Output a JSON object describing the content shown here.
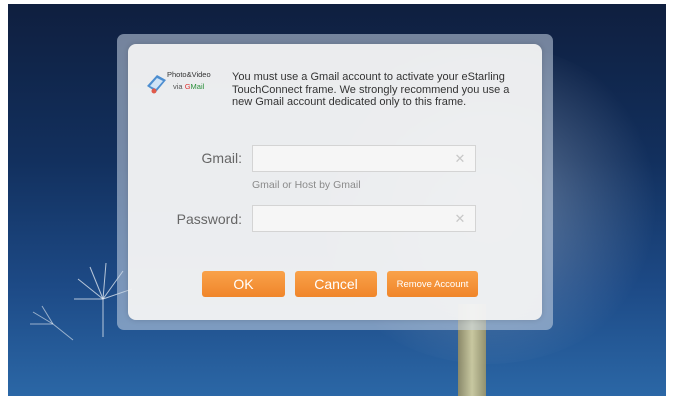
{
  "background": {
    "sky_colors": [
      "#0f1f3f",
      "#12305e",
      "#2b67a6"
    ],
    "description_icon": "dandelion-wallpaper"
  },
  "dialog": {
    "logo": {
      "icon": "photo-video-gmail-logo",
      "line1": "Photo&Video",
      "line2_prefix": "via",
      "line2_g": "G",
      "line2_m": "M",
      "line2_suffix": "ail"
    },
    "message": "You must use a Gmail account to activate your eStarling TouchConnect frame. We strongly recommend you use a new Gmail account dedicated only to this frame.",
    "gmail": {
      "label": "Gmail:",
      "value": "",
      "placeholder": "",
      "hint": "Gmail or Host by Gmail",
      "clear_icon": "clear-x-icon"
    },
    "password": {
      "label": "Password:",
      "value": "",
      "placeholder": "",
      "clear_icon": "clear-x-icon"
    },
    "buttons": {
      "ok": "OK",
      "cancel": "Cancel",
      "remove": "Remove Account"
    },
    "accent_color": "#f0852a"
  },
  "clear_glyph": "✕"
}
